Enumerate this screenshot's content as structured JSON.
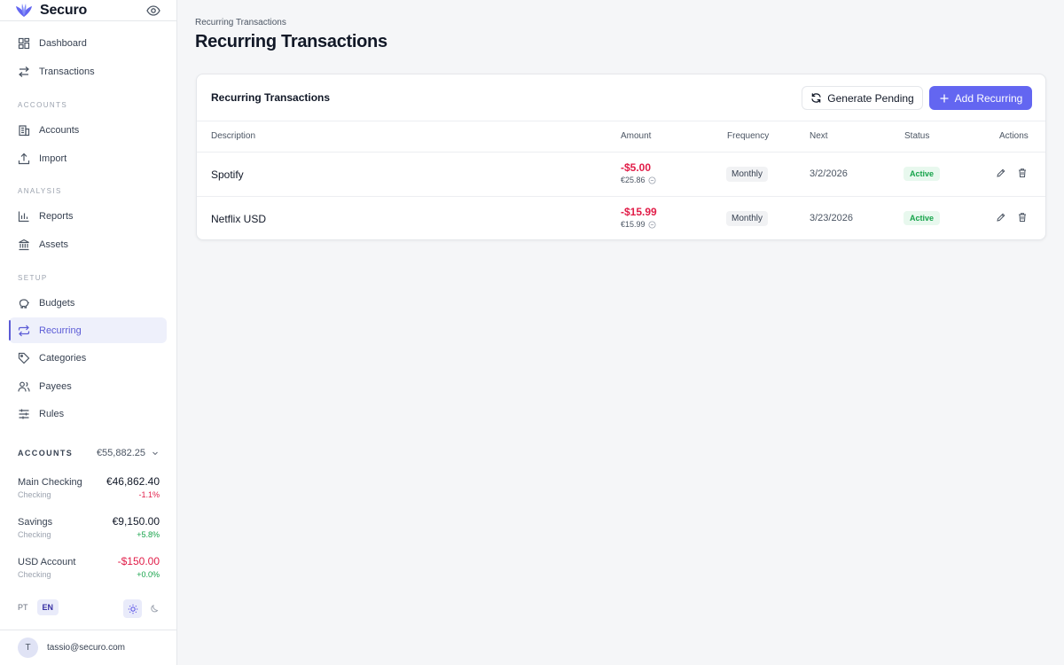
{
  "brand": {
    "name": "Securo",
    "accent": "#5b5bd6"
  },
  "nav": {
    "dashboard": "Dashboard",
    "transactions": "Transactions",
    "section_accounts": "ACCOUNTS",
    "accounts": "Accounts",
    "import": "Import",
    "section_analysis": "ANALYSIS",
    "reports": "Reports",
    "assets": "Assets",
    "section_setup": "SETUP",
    "budgets": "Budgets",
    "recurring": "Recurring",
    "categories": "Categories",
    "payees": "Payees",
    "rules": "Rules"
  },
  "accounts_panel": {
    "label": "ACCOUNTS",
    "total": "€55,882.25",
    "items": [
      {
        "name": "Main Checking",
        "type": "Checking",
        "balance": "€46,862.40",
        "change": "-1.1%"
      },
      {
        "name": "Savings",
        "type": "Checking",
        "balance": "€9,150.00",
        "change": "+5.8%"
      },
      {
        "name": "USD Account",
        "type": "Checking",
        "balance": "-$150.00",
        "change": "+0.0%"
      }
    ]
  },
  "language": {
    "options": [
      "PT",
      "EN"
    ],
    "selected": "EN"
  },
  "theme": {
    "selected": "light"
  },
  "user": {
    "initial": "T",
    "email": "tassio@securo.com"
  },
  "page": {
    "breadcrumb": "Recurring Transactions",
    "title": "Recurring Transactions"
  },
  "card": {
    "title": "Recurring Transactions",
    "generate_label": "Generate Pending",
    "add_label": "Add Recurring",
    "columns": [
      "Description",
      "Amount",
      "Frequency",
      "Next",
      "Status",
      "Actions"
    ],
    "rows": [
      {
        "description": "Spotify",
        "amount": "-$5.00",
        "converted": "€25.86",
        "frequency": "Monthly",
        "next": "3/2/2026",
        "status": "Active"
      },
      {
        "description": "Netflix USD",
        "amount": "-$15.99",
        "converted": "€15.99",
        "frequency": "Monthly",
        "next": "3/23/2026",
        "status": "Active"
      }
    ]
  }
}
